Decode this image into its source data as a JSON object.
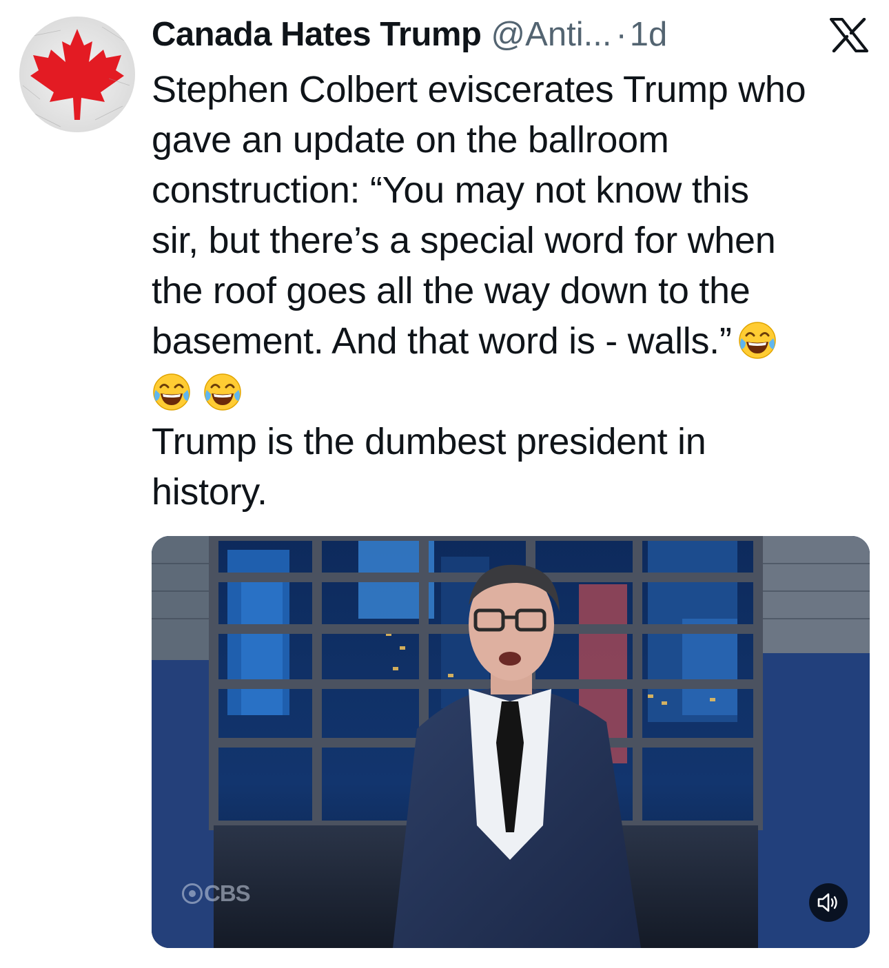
{
  "author": {
    "display_name": "Canada Hates Trump",
    "handle": "@Anti...",
    "separator": "·",
    "time": "1d",
    "avatar_icon": "maple-leaf-icon"
  },
  "platform_icon": "x-logo-icon",
  "tweet": {
    "lines": [
      "Stephen Colbert eviscerates Trump who",
      "gave an update on the ballroom",
      "construction: “You may not know this",
      "sir, but there’s a special word for when",
      "the roof goes all the way down to the",
      "basement. And that word is - walls.”"
    ],
    "emoji": "laughing-crying-emoji",
    "emoji_count_row2": 2,
    "second_paragraph": [
      "Trump is the dumbest president in",
      "history."
    ]
  },
  "media": {
    "type": "video",
    "watermark": "CBS",
    "mute_icon": "speaker-icon"
  },
  "colors": {
    "text": "#0f1419",
    "secondary": "#536471",
    "maple_red": "#e31b23"
  }
}
